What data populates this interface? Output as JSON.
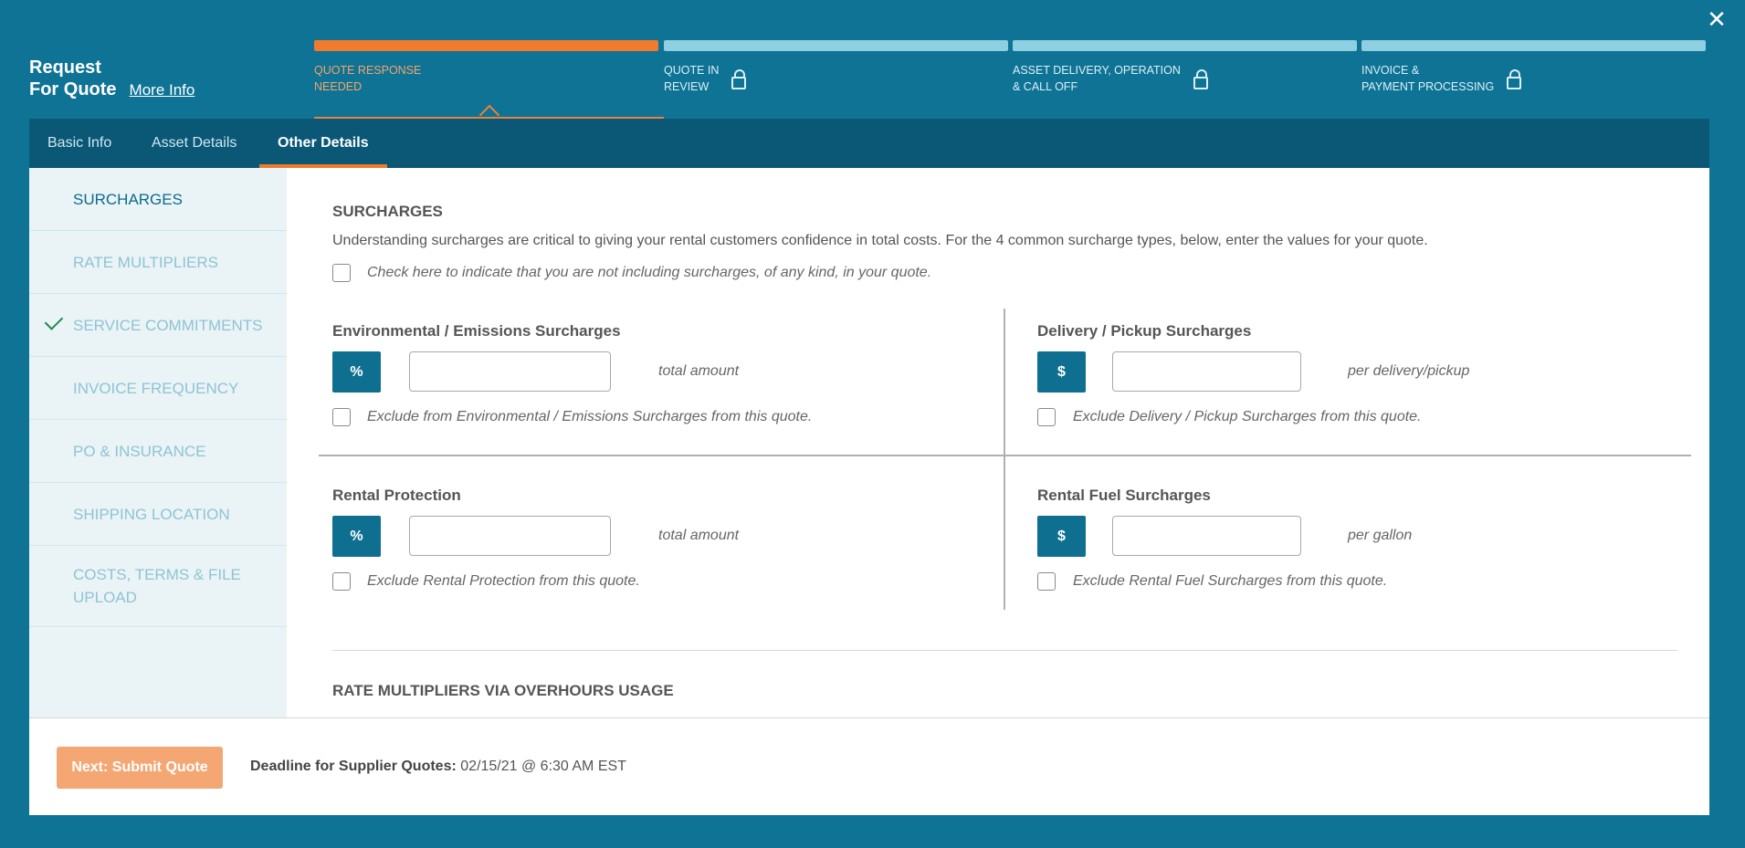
{
  "header": {
    "title_line1": "Request",
    "title_line2": "For Quote",
    "more_info": "More Info",
    "close_icon": "close-icon"
  },
  "steps": [
    {
      "label": "QUOTE RESPONSE\nNEEDED",
      "active": true,
      "locked": false
    },
    {
      "label": "QUOTE IN\nREVIEW",
      "active": false,
      "locked": true
    },
    {
      "label": "ASSET DELIVERY, OPERATION\n& CALL OFF",
      "active": false,
      "locked": true
    },
    {
      "label": "INVOICE &\nPAYMENT PROCESSING",
      "active": false,
      "locked": true
    }
  ],
  "tabs": [
    {
      "label": "Basic Info",
      "active": false
    },
    {
      "label": "Asset Details",
      "active": false
    },
    {
      "label": "Other Details",
      "active": true
    }
  ],
  "sidenav": [
    {
      "label": "SURCHARGES",
      "active": true,
      "checked": false
    },
    {
      "label": "RATE MULTIPLIERS",
      "active": false,
      "checked": false
    },
    {
      "label": "SERVICE COMMITMENTS",
      "active": false,
      "checked": true
    },
    {
      "label": "INVOICE FREQUENCY",
      "active": false,
      "checked": false
    },
    {
      "label": "PO & INSURANCE",
      "active": false,
      "checked": false
    },
    {
      "label": "SHIPPING LOCATION",
      "active": false,
      "checked": false
    },
    {
      "label": "COSTS, TERMS & FILE UPLOAD",
      "active": false,
      "checked": false
    }
  ],
  "surcharges": {
    "heading": "SURCHARGES",
    "intro": "Understanding surcharges are critical to giving your rental customers confidence in total costs. For the 4 common surcharge types, below, enter the values for your quote.",
    "no_surcharges_label": "Check here to indicate that you are not including surcharges, of any kind, in your quote.",
    "environmental": {
      "title": "Environmental / Emissions Surcharges",
      "unit_button": "%",
      "value": "",
      "unit_text": "total amount",
      "exclude_label": "Exclude from Environmental / Emissions Surcharges from this quote."
    },
    "delivery": {
      "title": "Delivery / Pickup Surcharges",
      "unit_button": "$",
      "value": "",
      "unit_text": "per delivery/pickup",
      "exclude_label": "Exclude Delivery / Pickup Surcharges from this quote."
    },
    "protection": {
      "title": "Rental Protection",
      "unit_button": "%",
      "value": "",
      "unit_text": "total amount",
      "exclude_label": "Exclude Rental Protection from this quote."
    },
    "fuel": {
      "title": "Rental Fuel Surcharges",
      "unit_button": "$",
      "value": "",
      "unit_text": "per gallon",
      "exclude_label": "Exclude Rental Fuel Surcharges from this quote."
    }
  },
  "rate_multipliers": {
    "heading": "RATE MULTIPLIERS VIA OVERHOURS USAGE"
  },
  "footer": {
    "submit_label": "Next: Submit Quote",
    "deadline_label": "Deadline for Supplier Quotes:",
    "deadline_value": "02/15/21 @ 6:30 AM EST"
  },
  "colors": {
    "background": "#0e7394",
    "tabbar": "#0a5876",
    "accent_orange": "#f07b2e",
    "unit_button": "#0e6f90",
    "submit_button": "#f5a773",
    "check_green": "#1b8e4b"
  }
}
